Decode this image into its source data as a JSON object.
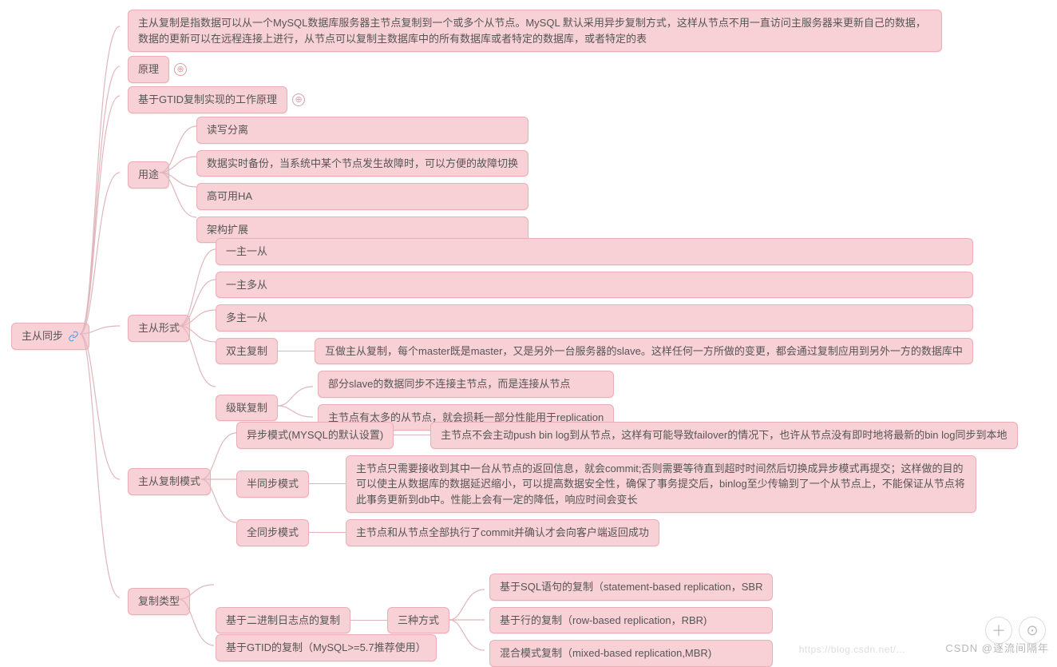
{
  "root": {
    "label": "主从同步"
  },
  "intro": "主从复制是指数据可以从一个MySQL数据库服务器主节点复制到一个或多个从节点。MySQL 默认采用异步复制方式，这样从节点不用一直访问主服务器来更新自己的数据，数据的更新可以在远程连接上进行，从节点可以复制主数据库中的所有数据库或者特定的数据库，或者特定的表",
  "principle": {
    "label": "原理"
  },
  "gtid_principle": {
    "label": "基于GTID复制实现的工作原理"
  },
  "usage": {
    "label": "用途",
    "items": [
      "读写分离",
      "数据实时备份，当系统中某个节点发生故障时，可以方便的故障切换",
      "高可用HA",
      "架构扩展"
    ]
  },
  "form": {
    "label": "主从形式",
    "oneMasterOneSlave": "一主一从",
    "oneMasterMultiSlave": "一主多从",
    "multiMasterOneSlave": "多主一从",
    "dualMaster": {
      "label": "双主复制",
      "desc": "互做主从复制，每个master既是master，又是另外一台服务器的slave。这样任何一方所做的变更，都会通过复制应用到另外一方的数据库中"
    },
    "cascade": {
      "label": "级联复制",
      "items": [
        "部分slave的数据同步不连接主节点，而是连接从节点",
        "主节点有太多的从节点，就会损耗一部分性能用于replication"
      ]
    }
  },
  "mode": {
    "label": "主从复制模式",
    "async": {
      "label": "异步模式(MYSQL的默认设置)",
      "desc": "主节点不会主动push bin log到从节点，这样有可能导致failover的情况下，也许从节点没有即时地将最新的bin log同步到本地"
    },
    "semi": {
      "label": "半同步模式",
      "desc": "主节点只需要接收到其中一台从节点的返回信息，就会commit;否则需要等待直到超时时间然后切换成异步模式再提交；这样做的目的可以使主从数据库的数据延迟缩小，可以提高数据安全性，确保了事务提交后，binlog至少传输到了一个从节点上，不能保证从节点将此事务更新到db中。性能上会有一定的降低，响应时间会变长"
    },
    "full": {
      "label": "全同步模式",
      "desc": "主节点和从节点全部执行了commit并确认才会向客户端返回成功"
    }
  },
  "type": {
    "label": "复制类型",
    "binlog": {
      "label": "基于二进制日志点的复制",
      "three": "三种方式",
      "items": [
        "基于SQL语句的复制（statement-based replication，SBR",
        "基于行的复制（row-based replication，RBR)",
        "混合模式复制（mixed-based replication,MBR)"
      ]
    },
    "gtid": "基于GTID的复制（MySQL>=5.7推荐使用）"
  },
  "watermark": "CSDN @逐流间隔年",
  "watermark2": "https://blog.csdn.net/..."
}
